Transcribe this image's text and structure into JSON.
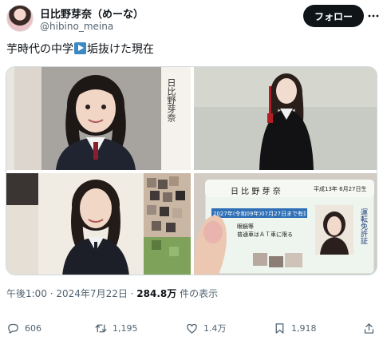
{
  "author": {
    "display_name": "日比野芽奈（めーな）",
    "handle": "@hibino_meina"
  },
  "follow_label": "フォロー",
  "tweet": {
    "text_before": "芋時代の中学",
    "text_after": "垢抜けた現在"
  },
  "media": {
    "photo1": {
      "name_plate": "日比野芽奈"
    },
    "photo4": {
      "name": "日 比 野 芽 奈",
      "issue": "平成13年 6月27日生",
      "expiry": "2027年(令和09年)07月27日まで有効",
      "conditions": "眼鏡等\n普通車はＡＴ車に限る",
      "side_label": "運転免許証"
    }
  },
  "meta": {
    "time_date": "午後1:00 · 2024年7月22日 · ",
    "views_count": "284.8万",
    "views_label": " 件の表示"
  },
  "actions": {
    "reply": "606",
    "retweet": "1,195",
    "like": "1.4万",
    "bookmark": "1,918"
  },
  "colors": {
    "text": "#0f1419",
    "secondary": "#536471",
    "follow_bg": "#0f1419",
    "play_emoji": "#3b88c3"
  }
}
